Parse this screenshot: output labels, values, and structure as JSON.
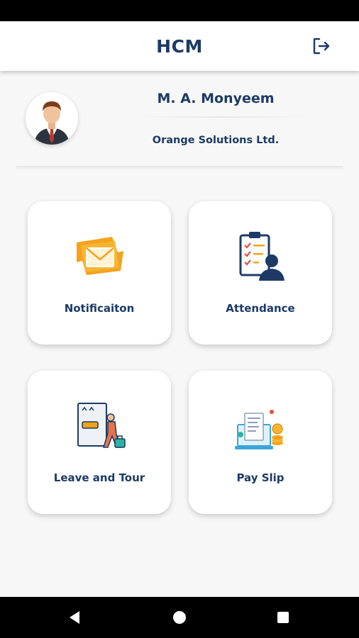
{
  "app_bar": {
    "title": "HCM",
    "logout_icon": "logout-icon"
  },
  "profile": {
    "name": "M. A. Monyeem",
    "company": "Orange Solutions Ltd.",
    "avatar_icon": "businessman-avatar"
  },
  "menu": {
    "items": [
      {
        "label": "Notificaiton",
        "icon": "envelope-icon"
      },
      {
        "label": "Attendance",
        "icon": "clipboard-person-icon"
      },
      {
        "label": "Leave and Tour",
        "icon": "traveler-luggage-icon"
      },
      {
        "label": "Pay Slip",
        "icon": "payslip-laptop-icon"
      }
    ]
  },
  "system_nav": {
    "back": "back-icon",
    "home": "home-icon",
    "recents": "recents-icon"
  },
  "colors": {
    "primary_text": "#1d3a66",
    "background": "#f7f7f7",
    "accent_orange": "#f5a21b"
  }
}
